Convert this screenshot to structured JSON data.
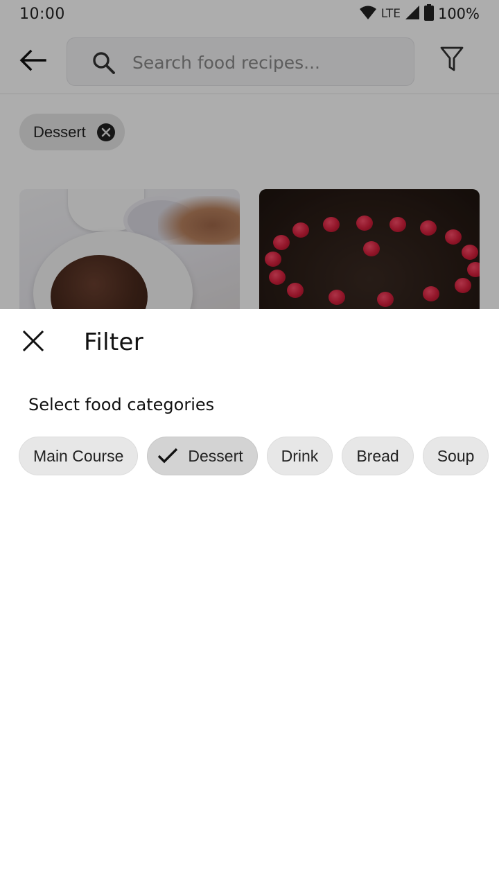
{
  "status_bar": {
    "time": "10:00",
    "network": "LTE",
    "battery": "100%",
    "icons": [
      "wifi-icon",
      "signal-icon",
      "battery-icon"
    ]
  },
  "toolbar": {
    "back_icon": "arrow-left-icon",
    "search": {
      "placeholder": "Search food recipes...",
      "value": "",
      "icon": "search-icon"
    },
    "filter_icon": "filter-icon"
  },
  "active_filters": [
    {
      "label": "Dessert",
      "remove_icon": "close-circle-icon"
    }
  ],
  "recipe_cards": [
    {
      "image": "chocolate-mousse-photo"
    },
    {
      "image": "raspberry-chocolate-cake-photo"
    }
  ],
  "filter_sheet": {
    "close_icon": "close-icon",
    "title": "Filter",
    "section_label": "Select food categories",
    "categories": [
      {
        "label": "Main Course",
        "selected": false
      },
      {
        "label": "Dessert",
        "selected": true
      },
      {
        "label": "Drink",
        "selected": false
      },
      {
        "label": "Bread",
        "selected": false
      },
      {
        "label": "Soup",
        "selected": false
      }
    ]
  },
  "colors": {
    "scrim": "#000000",
    "chip_background": "#e7e7e7",
    "chip_selected_background": "#d3d3d3",
    "text_primary": "#111111"
  }
}
